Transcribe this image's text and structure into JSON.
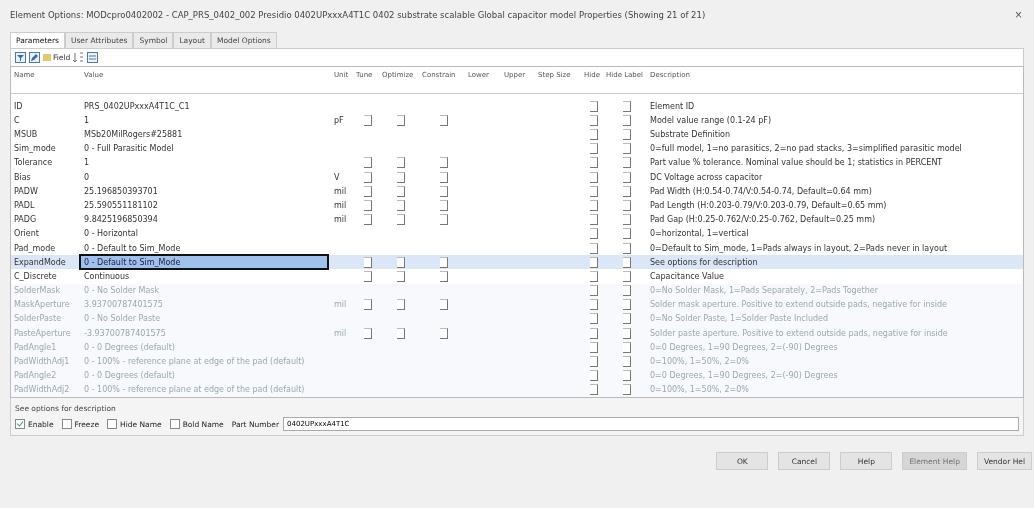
{
  "window": {
    "title": "Element Options: MODcpro0402002 - CAP_PRS_0402_002 Presidio 0402UPxxxA4T1C 0402 substrate scalable Global capacitor model Properties (Showing 21 of 21)",
    "close": "×"
  },
  "tabs": [
    {
      "label": "Parameters",
      "selected": true
    },
    {
      "label": "User Attributes",
      "selected": false
    },
    {
      "label": "Symbol",
      "selected": false
    },
    {
      "label": "Layout",
      "selected": false
    },
    {
      "label": "Model Options",
      "selected": false
    }
  ],
  "toolbar": {
    "field_label": "Field"
  },
  "table": {
    "columns": [
      "Name",
      "Value",
      "Unit",
      "Tune",
      "Optimize",
      "Constrain",
      "Lower",
      "Upper",
      "Step Size",
      "Hide",
      "Hide Label",
      "Description"
    ],
    "rows": [
      {
        "name": "ID",
        "value": "PRS_0402UPxxxA4T1C_C1",
        "unit": "",
        "kind": "plain",
        "disabled": false,
        "selected": false,
        "description": "Element ID"
      },
      {
        "name": "C",
        "value": "1",
        "unit": "pF",
        "kind": "tunable",
        "disabled": false,
        "selected": false,
        "description": "Model value range (0.1-24 pF)"
      },
      {
        "name": "MSUB",
        "value": "MSb20MilRogers#25881",
        "unit": "",
        "kind": "plain",
        "disabled": false,
        "selected": false,
        "description": "Substrate Definition"
      },
      {
        "name": "Sim_mode",
        "value": "0 - Full Parasitic Model",
        "unit": "",
        "kind": "plain",
        "disabled": false,
        "selected": false,
        "description": "0=full model, 1=no parasitics, 2=no pad stacks, 3=simplified parasitic model"
      },
      {
        "name": "Tolerance",
        "value": "1",
        "unit": "",
        "kind": "tunable",
        "disabled": false,
        "selected": false,
        "description": "Part value % tolerance. Nominal value should be 1; statistics in PERCENT"
      },
      {
        "name": "Bias",
        "value": "0",
        "unit": "V",
        "kind": "tunable",
        "disabled": false,
        "selected": false,
        "description": "DC Voltage across capacitor"
      },
      {
        "name": "PADW",
        "value": "25.196850393701",
        "unit": "mil",
        "kind": "tunable",
        "disabled": false,
        "selected": false,
        "description": "Pad Width (H:0.54-0.74/V:0.54-0.74, Default=0.64 mm)"
      },
      {
        "name": "PADL",
        "value": "25.590551181102",
        "unit": "mil",
        "kind": "tunable",
        "disabled": false,
        "selected": false,
        "description": "Pad Length (H:0.203-0.79/V:0.203-0.79, Default=0.65 mm)"
      },
      {
        "name": "PADG",
        "value": "9.8425196850394",
        "unit": "mil",
        "kind": "tunable",
        "disabled": false,
        "selected": false,
        "description": "Pad Gap (H:0.25-0.762/V:0.25-0.762, Default=0.25 mm)"
      },
      {
        "name": "Orient",
        "value": "0 - Horizontal",
        "unit": "",
        "kind": "plain",
        "disabled": false,
        "selected": false,
        "description": "0=horizontal, 1=vertical"
      },
      {
        "name": "Pad_mode",
        "value": "0 - Default to Sim_Mode",
        "unit": "",
        "kind": "plain",
        "disabled": false,
        "selected": false,
        "description": "0=Default to Sim_mode, 1=Pads always in layout, 2=Pads never in layout"
      },
      {
        "name": "ExpandMode",
        "value": "0 - Default to Sim_Mode",
        "unit": "",
        "kind": "tunable",
        "disabled": false,
        "selected": true,
        "description": "See options for description"
      },
      {
        "name": "C_Discrete",
        "value": "Continuous",
        "unit": "",
        "kind": "tunable",
        "disabled": false,
        "selected": false,
        "description": "Capacitance Value"
      },
      {
        "name": "SolderMask",
        "value": "0 - No Solder Mask",
        "unit": "",
        "kind": "plain",
        "disabled": true,
        "selected": false,
        "description": "0=No Solder Mask, 1=Pads Separately, 2=Pads Together"
      },
      {
        "name": "MaskAperture",
        "value": "3.93700787401575",
        "unit": "mil",
        "kind": "tunable",
        "disabled": true,
        "selected": false,
        "description": "Solder mask aperture. Positive to extend outside pads, negative for inside"
      },
      {
        "name": "SolderPaste",
        "value": "0 - No Solder Paste",
        "unit": "",
        "kind": "plain",
        "disabled": true,
        "selected": false,
        "description": "0=No Solder Paste, 1=Solder Paste Included"
      },
      {
        "name": "PasteAperture",
        "value": "-3.93700787401575",
        "unit": "mil",
        "kind": "tunable",
        "disabled": true,
        "selected": false,
        "description": "Solder paste aperture. Positive to extend outside pads, negative for inside"
      },
      {
        "name": "PadAngle1",
        "value": "0 - 0 Degrees (default)",
        "unit": "",
        "kind": "plain",
        "disabled": true,
        "selected": false,
        "description": "0=0 Degrees, 1=90 Degrees, 2=(-90) Degrees"
      },
      {
        "name": "PadWidthAdj1",
        "value": "0 - 100% - reference plane at edge of the pad (default)",
        "unit": "",
        "kind": "plain",
        "disabled": true,
        "selected": false,
        "description": "0=100%, 1=50%, 2=0%"
      },
      {
        "name": "PadAngle2",
        "value": "0 - 0 Degrees (default)",
        "unit": "",
        "kind": "plain",
        "disabled": true,
        "selected": false,
        "description": "0=0 Degrees, 1=90 Degrees, 2=(-90) Degrees"
      },
      {
        "name": "PadWidthAdj2",
        "value": "0 - 100% - reference plane at edge of the pad (default)",
        "unit": "",
        "kind": "plain",
        "disabled": true,
        "selected": false,
        "description": "0=100%, 1=50%, 2=0%"
      }
    ]
  },
  "description_text": "See options for description",
  "options": [
    {
      "label": "Enable",
      "checked": true
    },
    {
      "label": "Freeze",
      "checked": false
    },
    {
      "label": "Hide Name",
      "checked": false
    },
    {
      "label": "Bold Name",
      "checked": false
    }
  ],
  "part_number": {
    "label": "Part Number",
    "value": "0402UPxxxA4T1C"
  },
  "buttons": [
    {
      "label": "OK",
      "disabled": false
    },
    {
      "label": "Cancel",
      "disabled": false
    },
    {
      "label": "Help",
      "disabled": false
    },
    {
      "label": "Element Help",
      "disabled": true
    },
    {
      "label": "Vendor Hel",
      "disabled": false
    }
  ]
}
